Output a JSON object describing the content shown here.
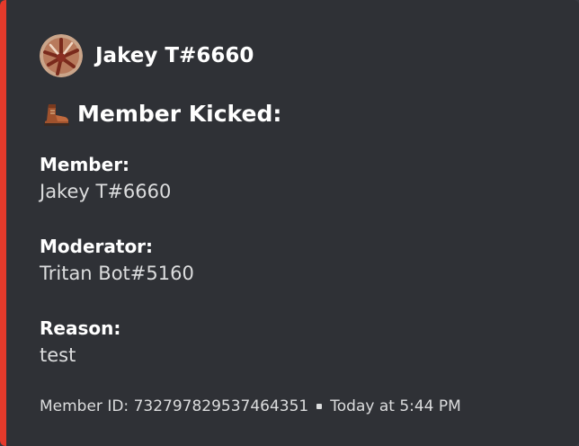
{
  "colors": {
    "accent": "#e43a2b",
    "embed_bg": "#2f3136"
  },
  "author": {
    "name": "Jakey T#6660",
    "avatar_icon": "user-avatar"
  },
  "title": {
    "emoji": "boot-icon",
    "text": "Member Kicked:"
  },
  "fields": [
    {
      "name": "Member:",
      "value": "Jakey T#6660"
    },
    {
      "name": "Moderator:",
      "value": "Tritan Bot#5160"
    },
    {
      "name": "Reason:",
      "value": "test"
    }
  ],
  "footer": {
    "member_id": "Member ID: 732797829537464351",
    "separator": "•",
    "timestamp": "Today at 5:44 PM"
  }
}
